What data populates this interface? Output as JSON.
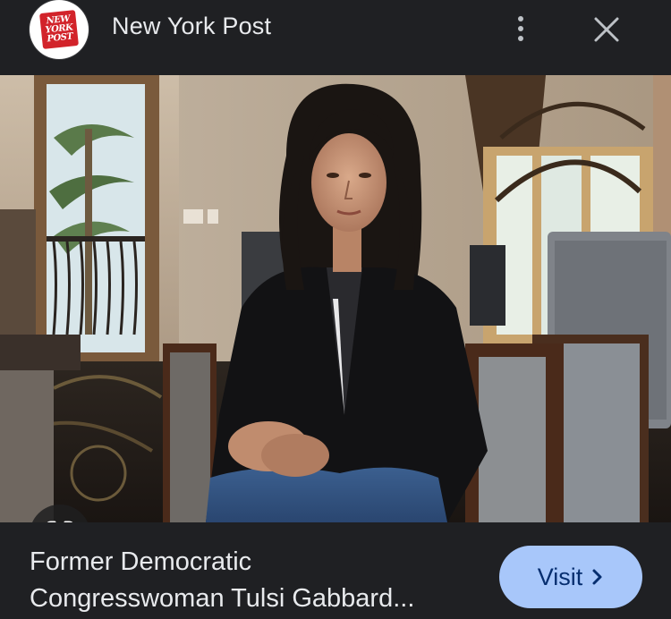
{
  "header": {
    "logo_lines": [
      "NEW",
      "YORK",
      "POST"
    ],
    "title": "New York Post",
    "more_icon": "more-vertical-icon",
    "close_icon": "close-icon"
  },
  "image": {
    "lens_icon": "google-lens-icon"
  },
  "footer": {
    "caption": "Former Democratic\nCongresswoman Tulsi Gabbard...",
    "visit_label": "Visit",
    "visit_icon": "chevron-right-icon"
  },
  "colors": {
    "background": "#1f2023",
    "text": "#e8eaed",
    "visit_button_bg": "#a8c7fa",
    "visit_button_text": "#062e6f",
    "logo_red": "#d2232a"
  }
}
